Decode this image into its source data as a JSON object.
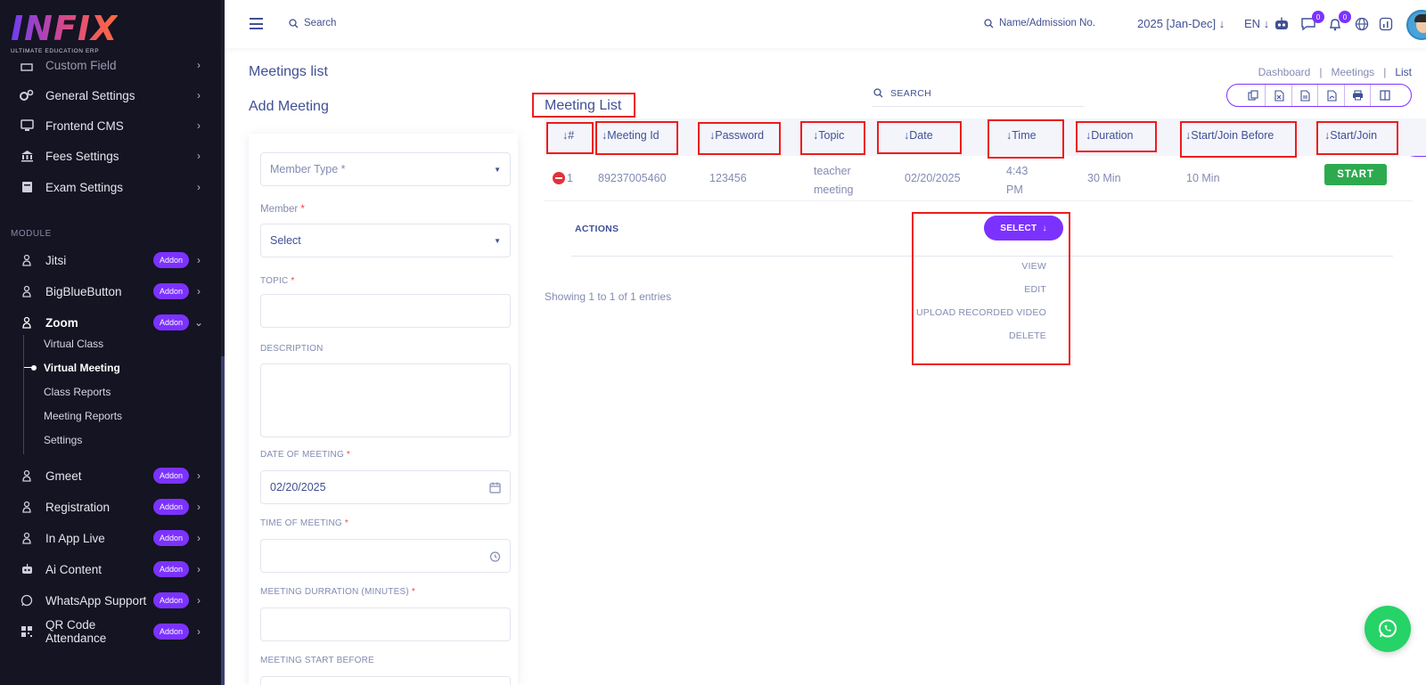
{
  "logo": {
    "mark": "INFIX",
    "tagline": "ULTIMATE EDUCATION ERP"
  },
  "sidebar": {
    "items_top": [
      {
        "label": "Custom Field"
      },
      {
        "label": "General Settings"
      },
      {
        "label": "Frontend CMS"
      },
      {
        "label": "Fees Settings"
      },
      {
        "label": "Exam Settings"
      }
    ],
    "module_label": "MODULE",
    "addon_label": "Addon",
    "modules": [
      {
        "label": "Jitsi"
      },
      {
        "label": "BigBlueButton"
      },
      {
        "label": "Zoom"
      },
      {
        "label": "Gmeet"
      },
      {
        "label": "Registration"
      },
      {
        "label": "In App Live"
      },
      {
        "label": "Ai Content"
      },
      {
        "label": "WhatsApp Support"
      },
      {
        "label": "QR Code Attendance"
      }
    ],
    "zoom_sub": [
      {
        "label": "Virtual Class"
      },
      {
        "label": "Virtual Meeting"
      },
      {
        "label": "Class Reports"
      },
      {
        "label": "Meeting Reports"
      },
      {
        "label": "Settings"
      }
    ]
  },
  "header": {
    "search_label": "Search",
    "student_search_label": "Name/Admission No.",
    "session": "2025 [Jan-Dec]",
    "language": "EN",
    "messages_count": "0",
    "notifications_count": "0"
  },
  "page": {
    "title": "Meetings list",
    "breadcrumb": [
      "Dashboard",
      "Meetings",
      "List"
    ],
    "add_title": "Add Meeting"
  },
  "form": {
    "member_type_placeholder": "Member Type *",
    "member_label": "Member",
    "member_value": "Select",
    "topic_label": "TOPIC",
    "description_label": "DESCRIPTION",
    "date_label": "DATE OF MEETING",
    "date_value": "02/20/2025",
    "time_label": "TIME OF MEETING",
    "duration_label": "MEETING DURRATION (MINUTES)",
    "start_before_label": "MEETING START BEFORE",
    "required_mark": "*"
  },
  "meeting_list": {
    "title": "Meeting List",
    "search_label": "SEARCH",
    "columns": [
      "#",
      "Meeting Id",
      "Password",
      "Topic",
      "Date",
      "Time",
      "Duration",
      "Start/Join Before",
      "Start/Join"
    ],
    "rows": [
      {
        "index": "1",
        "meeting_id": "89237005460",
        "password": "123456",
        "topic_line1": "teacher",
        "topic_line2": "meeting",
        "date": "02/20/2025",
        "time_line1": "4:43",
        "time_line2": "PM",
        "duration": "30 Min",
        "join_before": "10 Min",
        "start_label": "START"
      }
    ],
    "actions_label": "ACTIONS",
    "select_label": "SELECT",
    "dropdown": [
      "VIEW",
      "EDIT",
      "UPLOAD RECORDED VIDEO",
      "DELETE"
    ],
    "footer": "Showing 1 to 1 of 1 entries"
  },
  "colors": {
    "accent": "#7c32ff",
    "primary_text": "#415094",
    "muted_text": "#828bb2",
    "start_green": "#2daa4f",
    "highlight_red": "#ee1c1c",
    "whatsapp": "#25d366"
  },
  "icons": {
    "export_buttons": [
      "copy-icon",
      "excel-icon",
      "csv-icon",
      "pdf-icon",
      "print-icon",
      "columns-icon"
    ]
  }
}
